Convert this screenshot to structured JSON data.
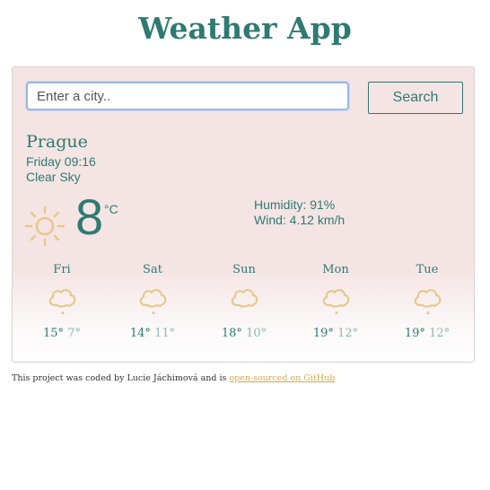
{
  "app": {
    "title": "Weather App"
  },
  "search": {
    "placeholder": "Enter a city..",
    "button_label": "Search"
  },
  "current": {
    "city": "Prague",
    "datetime": "Friday 09:16",
    "description": "Clear Sky",
    "icon": "sun-icon",
    "temperature": "8",
    "unit": "°C",
    "humidity": "Humidity: 91%",
    "wind": "Wind: 4.12 km/h"
  },
  "forecast": [
    {
      "day": "Fri",
      "max": "15°",
      "min": "7°",
      "icon": "cloud-drizzle-icon"
    },
    {
      "day": "Sat",
      "max": "14°",
      "min": "11°",
      "icon": "cloud-drizzle-icon"
    },
    {
      "day": "Sun",
      "max": "18°",
      "min": "10°",
      "icon": "cloud-icon"
    },
    {
      "day": "Mon",
      "max": "19°",
      "min": "12°",
      "icon": "cloud-drizzle-icon"
    },
    {
      "day": "Tue",
      "max": "19°",
      "min": "12°",
      "icon": "cloud-drizzle-icon"
    }
  ],
  "footer": {
    "text": "This project was coded by Lucie Jáchimová and is ",
    "link_text": "open-sourced on GitHub"
  },
  "colors": {
    "accent": "#2f7a72",
    "icon": "#e8c88a",
    "link": "#d7a84e",
    "card_bg": "#f4e4e3"
  }
}
